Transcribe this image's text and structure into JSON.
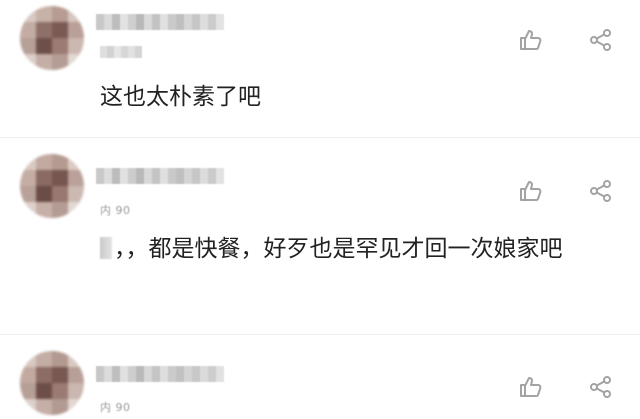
{
  "comments": [
    {
      "text": "这也太朴素了吧",
      "meta": ""
    },
    {
      "text": "，，都是快餐，好歹也是罕见才回一次娘家吧",
      "meta": "内 90"
    },
    {
      "text": "",
      "meta": "内 90"
    }
  ],
  "icons": {
    "like": "thumbs-up-icon",
    "share": "share-icon"
  },
  "colors": {
    "text": "#222222",
    "icon": "#a3a3a3",
    "divider": "#efefef"
  }
}
